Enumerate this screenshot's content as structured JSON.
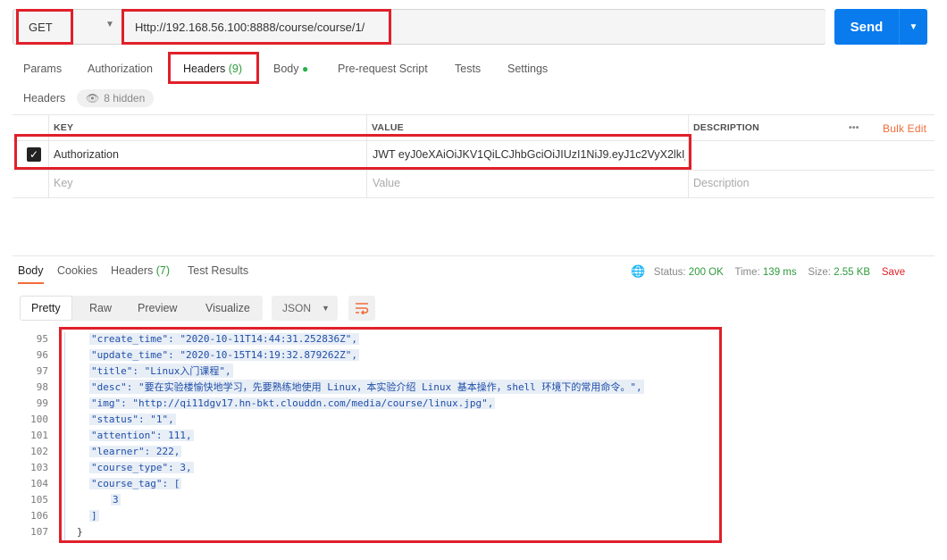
{
  "request": {
    "method": "GET",
    "url": "Http://192.168.56.100:8888/course/course/1/",
    "send_label": "Send"
  },
  "request_tabs": [
    {
      "label": "Params"
    },
    {
      "label": "Authorization"
    },
    {
      "label": "Headers",
      "count": "(9)"
    },
    {
      "label": "Body"
    },
    {
      "label": "Pre-request Script"
    },
    {
      "label": "Tests"
    },
    {
      "label": "Settings"
    }
  ],
  "headers_panel": {
    "title": "Headers",
    "hidden_label": "8 hidden",
    "columns": {
      "key": "KEY",
      "value": "VALUE",
      "description": "DESCRIPTION"
    },
    "more": "•••",
    "bulk_edit": "Bulk Edit",
    "row": {
      "key": "Authorization",
      "value": "JWT eyJ0eXAiOiJKV1QiLCJhbGciOiJIUzI1NiJ9.eyJ1c2VyX2lkIjc ..."
    },
    "placeholder": {
      "key": "Key",
      "value": "Value",
      "description": "Description"
    }
  },
  "response_tabs": [
    {
      "label": "Body"
    },
    {
      "label": "Cookies"
    },
    {
      "label": "Headers",
      "count": "(7)"
    },
    {
      "label": "Test Results"
    }
  ],
  "response_status": {
    "status_label": "Status:",
    "status_value": "200 OK",
    "time_label": "Time:",
    "time_value": "139 ms",
    "size_label": "Size:",
    "size_value": "2.55 KB",
    "save": "Save"
  },
  "view_modes": [
    "Pretty",
    "Raw",
    "Preview",
    "Visualize"
  ],
  "format": "JSON",
  "code_lines": [
    {
      "n": "95",
      "text": "\"create_time\": \"2020-10-11T14:44:31.252836Z\","
    },
    {
      "n": "96",
      "text": "\"update_time\": \"2020-10-15T14:19:32.879262Z\","
    },
    {
      "n": "97",
      "text": "\"title\": \"Linux入门课程\","
    },
    {
      "n": "98",
      "text": "\"desc\": \"要在实验楼愉快地学习，先要熟练地使用 Linux，本实验介绍 Linux 基本操作，shell 环境下的常用命令。\","
    },
    {
      "n": "99",
      "text": "\"img\": \"http://qi11dgv17.hn-bkt.clouddn.com/media/course/linux.jpg\","
    },
    {
      "n": "100",
      "text": "\"status\": \"1\","
    },
    {
      "n": "101",
      "text": "\"attention\": 111,"
    },
    {
      "n": "102",
      "text": "\"learner\": 222,"
    },
    {
      "n": "103",
      "text": "\"course_type\": 3,"
    },
    {
      "n": "104",
      "text": "\"course_tag\": ["
    },
    {
      "n": "105",
      "text": "3"
    },
    {
      "n": "106",
      "text": "]"
    },
    {
      "n": "107",
      "text": "}"
    }
  ],
  "colors": {
    "accent": "#f26b3a",
    "send": "#097bed",
    "status_ok": "#2e9a3c",
    "highlight_box": "#e0202a"
  }
}
